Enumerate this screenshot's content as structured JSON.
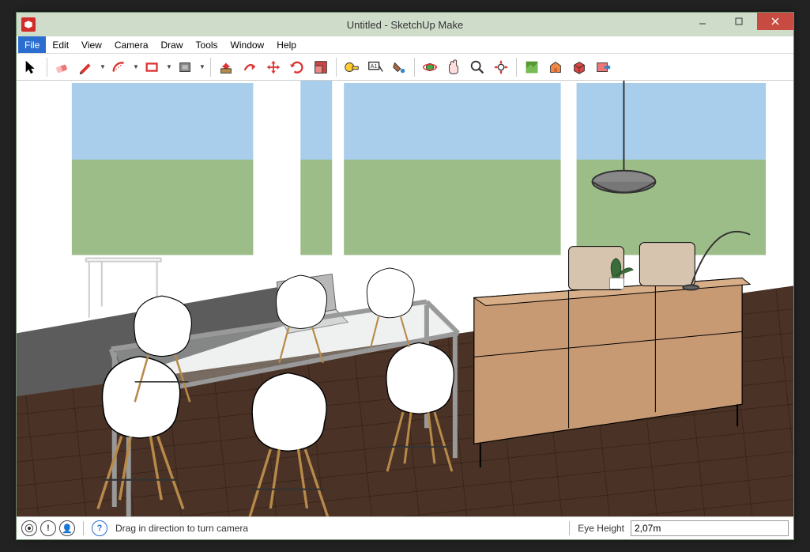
{
  "window": {
    "title": "Untitled - SketchUp Make"
  },
  "menu": {
    "items": [
      {
        "label": "File",
        "active": true
      },
      {
        "label": "Edit",
        "active": false
      },
      {
        "label": "View",
        "active": false
      },
      {
        "label": "Camera",
        "active": false
      },
      {
        "label": "Draw",
        "active": false
      },
      {
        "label": "Tools",
        "active": false
      },
      {
        "label": "Window",
        "active": false
      },
      {
        "label": "Help",
        "active": false
      }
    ]
  },
  "toolbar": {
    "groups": [
      [
        {
          "name": "select-tool",
          "glyph": "cursor"
        }
      ],
      [
        {
          "name": "eraser-tool",
          "glyph": "eraser"
        },
        {
          "name": "pencil-tool",
          "glyph": "pencil",
          "dropdown": true
        },
        {
          "name": "arc-tool",
          "glyph": "arc",
          "dropdown": true
        },
        {
          "name": "rectangle-tool",
          "glyph": "rect",
          "dropdown": true
        },
        {
          "name": "circle-tool",
          "glyph": "circle",
          "dropdown": true
        }
      ],
      [
        {
          "name": "pushpull-tool",
          "glyph": "pushpull"
        },
        {
          "name": "followme-tool",
          "glyph": "followme"
        },
        {
          "name": "move-tool",
          "glyph": "move"
        },
        {
          "name": "rotate-tool",
          "glyph": "rotate"
        },
        {
          "name": "scale-tool",
          "glyph": "scale"
        }
      ],
      [
        {
          "name": "tape-tool",
          "glyph": "tape"
        },
        {
          "name": "text-tool",
          "glyph": "text"
        },
        {
          "name": "paint-tool",
          "glyph": "paint"
        }
      ],
      [
        {
          "name": "orbit-tool",
          "glyph": "orbit"
        },
        {
          "name": "pan-tool",
          "glyph": "pan"
        },
        {
          "name": "zoom-tool",
          "glyph": "zoom"
        },
        {
          "name": "zoom-extents-tool",
          "glyph": "zoomext"
        }
      ],
      [
        {
          "name": "geolocation-tool",
          "glyph": "geo"
        },
        {
          "name": "warehouse-tool",
          "glyph": "warehouse"
        },
        {
          "name": "extensions-tool",
          "glyph": "extbox"
        },
        {
          "name": "share-tool",
          "glyph": "share"
        }
      ]
    ]
  },
  "status": {
    "hint": "Drag in direction to turn camera",
    "field_label": "Eye Height",
    "field_value": "2,07m"
  }
}
